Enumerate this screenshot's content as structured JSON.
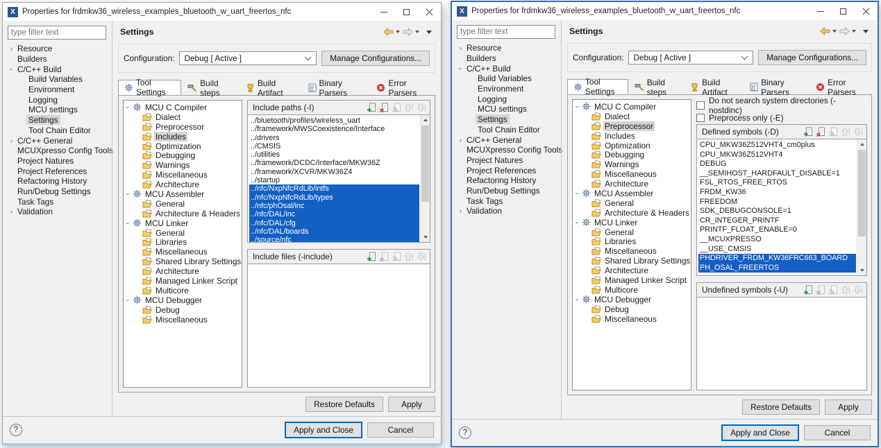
{
  "colors": {
    "selection_blue": "#1360c4",
    "active_window_border": "#3d6fb5",
    "app_icon_blue": "#2b5797",
    "tree_selected_gray": "#d5d5d5"
  },
  "chrome": {
    "title": "Properties for frdmkw36_wireless_examples_bluetooth_w_uart_freertos_nfc",
    "app_icon_glyph": "X",
    "filter_placeholder": "type filter text",
    "page_title": "Settings",
    "configuration_label": "Configuration:",
    "configuration_value": "Debug [ Active ]",
    "manage_button": "Manage Configurations...",
    "header_icons": [
      "back-arrow-icon",
      "forward-arrow-icon",
      "view-menu-icon"
    ],
    "tabs": [
      {
        "label": "Tool Settings",
        "state": "active ic-gear",
        "icon": "gear-icon"
      },
      {
        "label": "Build steps",
        "state": "ic-hammer",
        "icon": "hammer-icon"
      },
      {
        "label": "Build Artifact",
        "state": "ic-trophy",
        "icon": "trophy-icon"
      },
      {
        "label": "Binary Parsers",
        "state": "ic-binary",
        "icon": "binary-file-icon"
      },
      {
        "label": "Error Parsers",
        "state": "ic-error",
        "icon": "error-icon"
      }
    ],
    "list_toolbar_icons": [
      "add-icon",
      "delete-icon",
      "edit-icon",
      "move-up-icon",
      "move-down-icon"
    ],
    "restore_defaults": "Restore Defaults",
    "apply": "Apply",
    "apply_and_close": "Apply and Close",
    "cancel": "Cancel",
    "help_glyph": "?"
  },
  "sidebar_items": [
    {
      "label": "Resource",
      "state": "collapsed"
    },
    {
      "label": "Builders"
    },
    {
      "label": "C/C++ Build",
      "state": "expanded"
    },
    {
      "label": "Build Variables",
      "state": "lvl1"
    },
    {
      "label": "Environment",
      "state": "lvl1"
    },
    {
      "label": "Logging",
      "state": "lvl1"
    },
    {
      "label": "MCU settings",
      "state": "lvl1"
    },
    {
      "label": "Settings",
      "state": "lvl1 sel"
    },
    {
      "label": "Tool Chain Editor",
      "state": "lvl1"
    },
    {
      "label": "C/C++ General",
      "state": "collapsed"
    },
    {
      "label": "MCUXpresso Config Tools"
    },
    {
      "label": "Project Natures"
    },
    {
      "label": "Project References"
    },
    {
      "label": "Refactoring History"
    },
    {
      "label": "Run/Debug Settings"
    },
    {
      "label": "Task Tags"
    },
    {
      "label": "Validation",
      "state": "collapsed"
    }
  ],
  "tool_tree_left": [
    {
      "label": "MCU C Compiler",
      "state": "tool"
    },
    {
      "label": "Dialect",
      "state": "page"
    },
    {
      "label": "Preprocessor",
      "state": "page"
    },
    {
      "label": "Includes",
      "state": "page sel"
    },
    {
      "label": "Optimization",
      "state": "page"
    },
    {
      "label": "Debugging",
      "state": "page"
    },
    {
      "label": "Warnings",
      "state": "page"
    },
    {
      "label": "Miscellaneous",
      "state": "page"
    },
    {
      "label": "Architecture",
      "state": "page"
    },
    {
      "label": "MCU Assembler",
      "state": "tool"
    },
    {
      "label": "General",
      "state": "page"
    },
    {
      "label": "Architecture & Headers",
      "state": "page"
    },
    {
      "label": "MCU Linker",
      "state": "tool"
    },
    {
      "label": "General",
      "state": "page"
    },
    {
      "label": "Libraries",
      "state": "page"
    },
    {
      "label": "Miscellaneous",
      "state": "page"
    },
    {
      "label": "Shared Library Settings",
      "state": "page"
    },
    {
      "label": "Architecture",
      "state": "page"
    },
    {
      "label": "Managed Linker Script",
      "state": "page"
    },
    {
      "label": "Multicore",
      "state": "page"
    },
    {
      "label": "MCU Debugger",
      "state": "tool"
    },
    {
      "label": "Debug",
      "state": "page"
    },
    {
      "label": "Miscellaneous",
      "state": "page"
    }
  ],
  "tool_tree_right": [
    {
      "label": "MCU C Compiler",
      "state": "tool"
    },
    {
      "label": "Dialect",
      "state": "page"
    },
    {
      "label": "Preprocessor",
      "state": "page sel"
    },
    {
      "label": "Includes",
      "state": "page"
    },
    {
      "label": "Optimization",
      "state": "page"
    },
    {
      "label": "Debugging",
      "state": "page"
    },
    {
      "label": "Warnings",
      "state": "page"
    },
    {
      "label": "Miscellaneous",
      "state": "page"
    },
    {
      "label": "Architecture",
      "state": "page"
    },
    {
      "label": "MCU Assembler",
      "state": "tool"
    },
    {
      "label": "General",
      "state": "page"
    },
    {
      "label": "Architecture & Headers",
      "state": "page"
    },
    {
      "label": "MCU Linker",
      "state": "tool"
    },
    {
      "label": "General",
      "state": "page"
    },
    {
      "label": "Libraries",
      "state": "page"
    },
    {
      "label": "Miscellaneous",
      "state": "page"
    },
    {
      "label": "Shared Library Settings",
      "state": "page"
    },
    {
      "label": "Architecture",
      "state": "page"
    },
    {
      "label": "Managed Linker Script",
      "state": "page"
    },
    {
      "label": "Multicore",
      "state": "page"
    },
    {
      "label": "MCU Debugger",
      "state": "tool"
    },
    {
      "label": "Debug",
      "state": "page"
    },
    {
      "label": "Miscellaneous",
      "state": "page"
    }
  ],
  "left": {
    "include_paths": {
      "label": "Include paths (-I)",
      "items": [
        {
          "t": "../bluetooth/profiles/wireless_uart"
        },
        {
          "t": "../framework/MWSCoexistence/Interface"
        },
        {
          "t": "../drivers"
        },
        {
          "t": "../CMSIS"
        },
        {
          "t": "../utilities"
        },
        {
          "t": "../framework/DCDC/Interface/MKW36Z"
        },
        {
          "t": "../framework/XCVR/MKW36Z4"
        },
        {
          "t": "../startup"
        },
        {
          "t": "../nfc/NxpNfcRdLib/intfs",
          "state": "sel"
        },
        {
          "t": "../nfc/NxpNfcRdLib/types",
          "state": "sel"
        },
        {
          "t": "../nfc/phOsal/inc",
          "state": "sel"
        },
        {
          "t": "../nfc/DAL/inc",
          "state": "sel"
        },
        {
          "t": "../nfc/DAL/cfg",
          "state": "sel"
        },
        {
          "t": "../nfc/DAL/boards",
          "state": "sel"
        },
        {
          "t": "../source/nfc",
          "state": "sel"
        }
      ]
    },
    "include_files": {
      "label": "Include files (-include)",
      "items": []
    }
  },
  "right": {
    "checkboxes": [
      {
        "label": "Do not search system directories (-nostdinc)",
        "checked": false
      },
      {
        "label": "Preprocess only (-E)",
        "checked": false
      }
    ],
    "defined_symbols": {
      "label": "Defined symbols (-D)",
      "items": [
        {
          "t": "CPU_MKW36Z512VHT4_cm0plus"
        },
        {
          "t": "CPU_MKW36Z512VHT4"
        },
        {
          "t": "DEBUG"
        },
        {
          "t": "__SEMIHOST_HARDFAULT_DISABLE=1"
        },
        {
          "t": "FSL_RTOS_FREE_RTOS"
        },
        {
          "t": "FRDM_KW36"
        },
        {
          "t": "FREEDOM"
        },
        {
          "t": "SDK_DEBUGCONSOLE=1"
        },
        {
          "t": "CR_INTEGER_PRINTF"
        },
        {
          "t": "PRINTF_FLOAT_ENABLE=0"
        },
        {
          "t": "__MCUXPRESSO"
        },
        {
          "t": "__USE_CMSIS"
        },
        {
          "t": "PHDRIVER_FRDM_KW36FRC663_BOARD",
          "state": "sel"
        },
        {
          "t": "PH_OSAL_FREERTOS",
          "state": "sel"
        }
      ]
    },
    "undefined_symbols": {
      "label": "Undefined symbols (-U)",
      "items": []
    }
  }
}
